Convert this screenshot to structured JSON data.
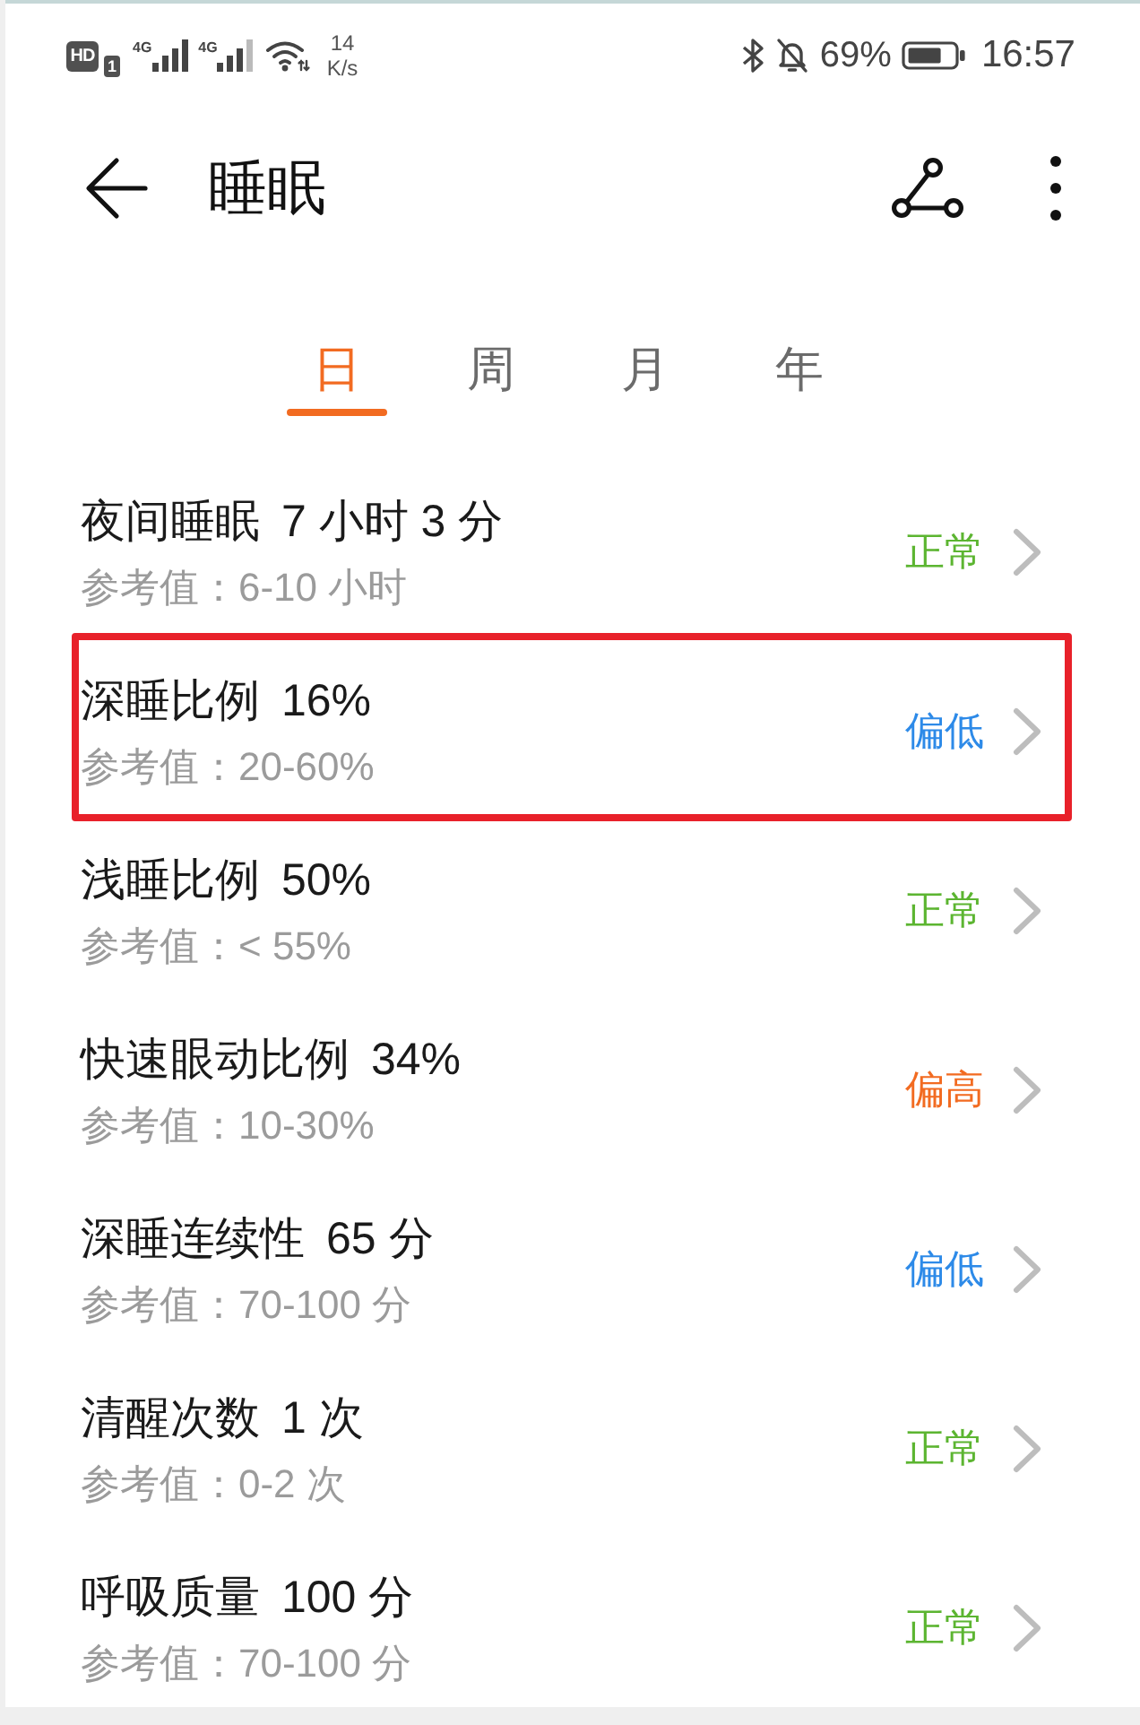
{
  "status_bar": {
    "hd_badge": "HD",
    "sim_slot": "1",
    "networks": [
      {
        "label": "4G"
      },
      {
        "label": "4G"
      }
    ],
    "speed": "14",
    "speed_unit": "K/s",
    "battery": "69%",
    "time": "16:57"
  },
  "header": {
    "title": "睡眠"
  },
  "tabs": [
    {
      "label": "日",
      "selected": true
    },
    {
      "label": "周",
      "selected": false
    },
    {
      "label": "月",
      "selected": false
    },
    {
      "label": "年",
      "selected": false
    }
  ],
  "rows": [
    {
      "title": "夜间睡眠",
      "value": "7 小时 3 分",
      "reference": "参考值：6-10 小时",
      "status": "正常",
      "kind": "normal",
      "highlighted": false
    },
    {
      "title": "深睡比例",
      "value": "16%",
      "reference": "参考值：20-60%",
      "status": "偏低",
      "kind": "low",
      "highlighted": true
    },
    {
      "title": "浅睡比例",
      "value": "50%",
      "reference": "参考值：< 55%",
      "status": "正常",
      "kind": "normal",
      "highlighted": false
    },
    {
      "title": "快速眼动比例",
      "value": "34%",
      "reference": "参考值：10-30%",
      "status": "偏高",
      "kind": "high",
      "highlighted": false
    },
    {
      "title": "深睡连续性",
      "value": "65 分",
      "reference": "参考值：70-100 分",
      "status": "偏低",
      "kind": "low",
      "highlighted": false
    },
    {
      "title": "清醒次数",
      "value": "1 次",
      "reference": "参考值：0-2 次",
      "status": "正常",
      "kind": "normal",
      "highlighted": false
    },
    {
      "title": "呼吸质量",
      "value": "100 分",
      "reference": "参考值：70-100 分",
      "status": "正常",
      "kind": "normal",
      "highlighted": false
    }
  ]
}
